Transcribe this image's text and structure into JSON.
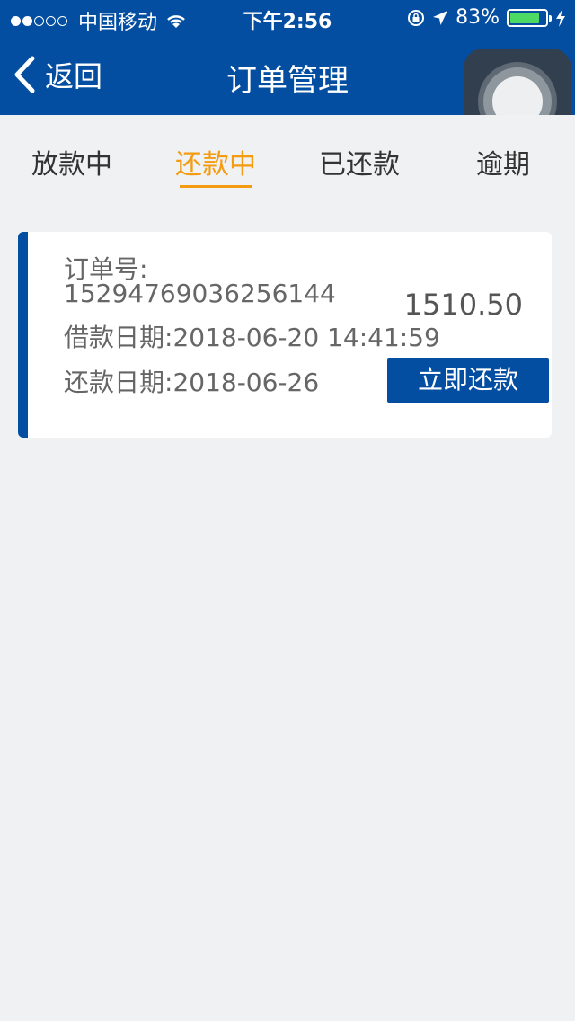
{
  "status_bar": {
    "carrier": "中国移动",
    "time": "下午2:56",
    "battery": "83%",
    "battery_level": 0.83,
    "signal_dots": [
      "on",
      "on",
      "off",
      "off",
      "off"
    ]
  },
  "nav": {
    "back_label": "返回",
    "title": "订单管理"
  },
  "tabs": [
    {
      "label": "放款中",
      "active": false
    },
    {
      "label": "还款中",
      "active": true
    },
    {
      "label": "已还款",
      "active": false
    },
    {
      "label": "逾期",
      "active": false
    }
  ],
  "order": {
    "order_no_label": "订单号:",
    "order_no": "15294769036256144",
    "amount": "1510.50",
    "borrow_date_label": "借款日期:",
    "borrow_date": "2018-06-20 14:41:59",
    "repay_date_label": "还款日期:",
    "repay_date": "2018-06-26",
    "pay_button": "立即还款"
  },
  "colors": {
    "primary": "#034ea1",
    "accent": "#f39c12",
    "background": "#f0f1f3",
    "battery": "#4cd964"
  },
  "icons": [
    "back-chevron-icon",
    "wifi-icon",
    "lock-rotation-icon",
    "location-arrow-icon",
    "charging-bolt-icon",
    "assistive-touch-icon"
  ]
}
